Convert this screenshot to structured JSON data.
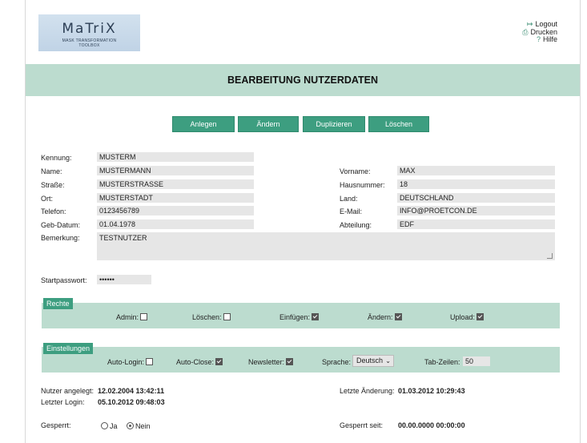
{
  "logo": {
    "title": "MaTriX",
    "subtitle_line1": "MASK TRANSFORMATION",
    "subtitle_line2": "TOOLBOX"
  },
  "toplinks": {
    "logout": "Logout",
    "drucken": "Drucken",
    "hilfe": "Hilfe",
    "logout_icon": "logout-icon",
    "print_icon": "printer-icon",
    "help_icon": "help-icon"
  },
  "banner": {
    "title": "BEARBEITUNG NUTZERDATEN"
  },
  "actions": {
    "anlegen": "Anlegen",
    "aendern": "Ändern",
    "duplizieren": "Duplizieren",
    "loeschen": "Löschen"
  },
  "form": {
    "kennung_label": "Kennung:",
    "kennung": "MUSTERM",
    "name_label": "Name:",
    "name": "MUSTERMANN",
    "strasse_label": "Straße:",
    "strasse": "MUSTERSTRASSE",
    "ort_label": "Ort:",
    "ort": "MUSTERSTADT",
    "telefon_label": "Telefon:",
    "telefon": "0123456789",
    "geburtsdatum_label": "Geb-Datum:",
    "geburtsdatum": "01.04.1978",
    "bemerkung_label": "Bemerkung:",
    "bemerkung": "TESTNUTZER",
    "vorname_label": "Vorname:",
    "vorname": "MAX",
    "hausnummer_label": "Hausnummer:",
    "hausnummer": "18",
    "land_label": "Land:",
    "land": "DEUTSCHLAND",
    "email_label": "E-Mail:",
    "email": "INFO@PROETCON.DE",
    "abteilung_label": "Abteilung:",
    "abteilung": "EDF",
    "startpasswort_label": "Startpasswort:",
    "startpasswort": "••••••"
  },
  "rechte": {
    "title": "Rechte",
    "admin": "Admin:",
    "admin_checked": false,
    "loeschen": "Löschen:",
    "loeschen_checked": false,
    "einfuegen": "Einfügen:",
    "einfuegen_checked": true,
    "aendern": "Ändern:",
    "aendern_checked": true,
    "upload": "Upload:",
    "upload_checked": true
  },
  "einstellungen": {
    "title": "Einstellungen",
    "autologin": "Auto-Login:",
    "autologin_checked": false,
    "autoclose": "Auto-Close:",
    "autoclose_checked": true,
    "newsletter": "Newsletter:",
    "newsletter_checked": true,
    "sprache": "Sprache:",
    "sprache_value": "Deutsch",
    "tabzeilen": "Tab-Zeilen:",
    "tabzeilen_value": "50"
  },
  "info": {
    "angelegt_label": "Nutzer angelegt:",
    "angelegt": "12.02.2004 13:42:11",
    "login_label": "Letzter Login:",
    "login": "05.10.2012 09:48:03",
    "aenderung_label": "Letzte Änderung:",
    "aenderung": "01.03.2012 10:29:43",
    "gesperrt_label": "Gesperrt:",
    "ja": "Ja",
    "nein": "Nein",
    "gesperrt_value": "Nein",
    "gesperrt_seit_label": "Gesperrt seit:",
    "gesperrt_seit": "00.00.0000 00:00:00"
  },
  "colors": {
    "accent": "#3d9e80",
    "banner": "#bcdccf",
    "field": "#e6e6e6"
  }
}
